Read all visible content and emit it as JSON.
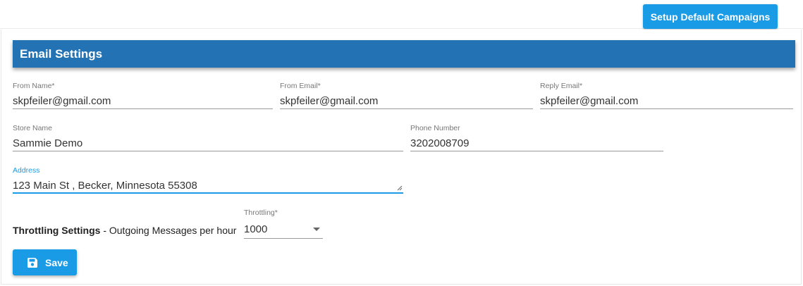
{
  "topbar": {
    "setup_button": "Setup Default Campaigns"
  },
  "panel": {
    "title": "Email Settings"
  },
  "fields": {
    "from_name": {
      "label": "From Name*",
      "value": "skpfeiler@gmail.com"
    },
    "from_email": {
      "label": "From Email*",
      "value": "skpfeiler@gmail.com"
    },
    "reply_email": {
      "label": "Reply Email*",
      "value": "skpfeiler@gmail.com"
    },
    "store_name": {
      "label": "Store Name",
      "value": "Sammie Demo"
    },
    "phone_number": {
      "label": "Phone Number",
      "value": "3202008709"
    },
    "address": {
      "label": "Address",
      "value": "123 Main St , Becker, Minnesota 55308"
    }
  },
  "throttling": {
    "heading": "Throttling Settings",
    "description": " - Outgoing Messages per hour",
    "select_label": "Throttling*",
    "selected": "1000"
  },
  "actions": {
    "save_label": "Save"
  },
  "icons": {
    "save": "floppy-disk-icon",
    "dropdown": "caret-down-icon",
    "resize": "resize-grip-icon"
  },
  "colors": {
    "accent": "#1a9be6",
    "header": "#2373b4"
  }
}
